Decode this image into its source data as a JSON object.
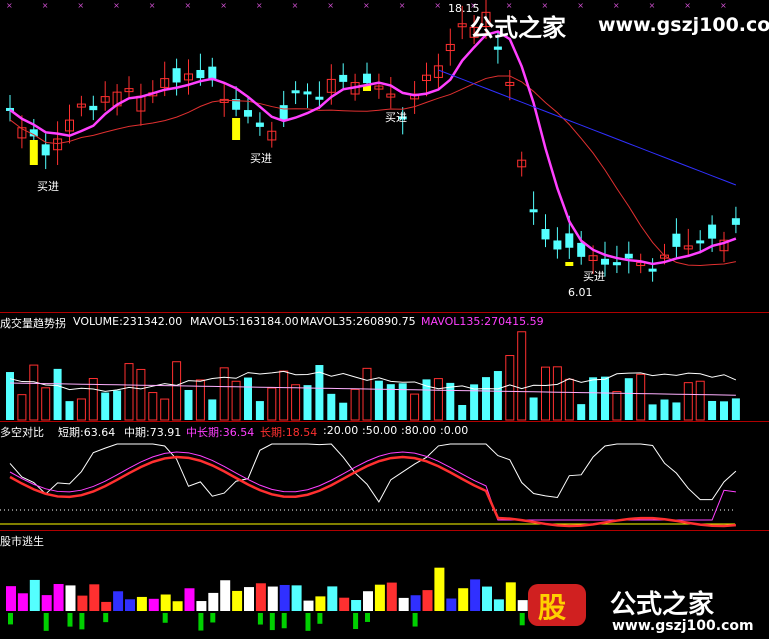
{
  "watermark_top": {
    "cn": "公式之家",
    "url": "www.gszj100.com"
  },
  "watermark_bottom": {
    "cn": "公式之家",
    "url": "www.gszj100.com",
    "badge": "股"
  },
  "price_panel": {
    "high_label": "18.15",
    "low_label": "6.01",
    "buy_signals": [
      "买进",
      "买进",
      "买进",
      "买进"
    ]
  },
  "volume_panel": {
    "title": "成交量趋势拐",
    "volume": "VOLUME:231342.00",
    "mavol5": "MAVOL5:163184.00",
    "mavol35": "MAVOL35:260890.75",
    "mavol135": "MAVOL135:270415.59"
  },
  "ratio_panel": {
    "title": "多空对比",
    "short": "短期:63.64",
    "mid": "中期:73.91",
    "midlong": "中长期:36.54",
    "long": "长期:18.54",
    "levels": [
      ":20.00",
      ":50.00",
      ":80.00",
      ":0.00"
    ]
  },
  "escape_panel": {
    "title": "股市逃生"
  },
  "colors": {
    "up": "#ff3030",
    "down": "#54ffff",
    "ma_pink": "#ff40ff",
    "ma_red": "#e03030",
    "ma_blue": "#3030ff",
    "white": "#ffffff",
    "yellow": "#ffff00",
    "green": "#00d000"
  }
}
